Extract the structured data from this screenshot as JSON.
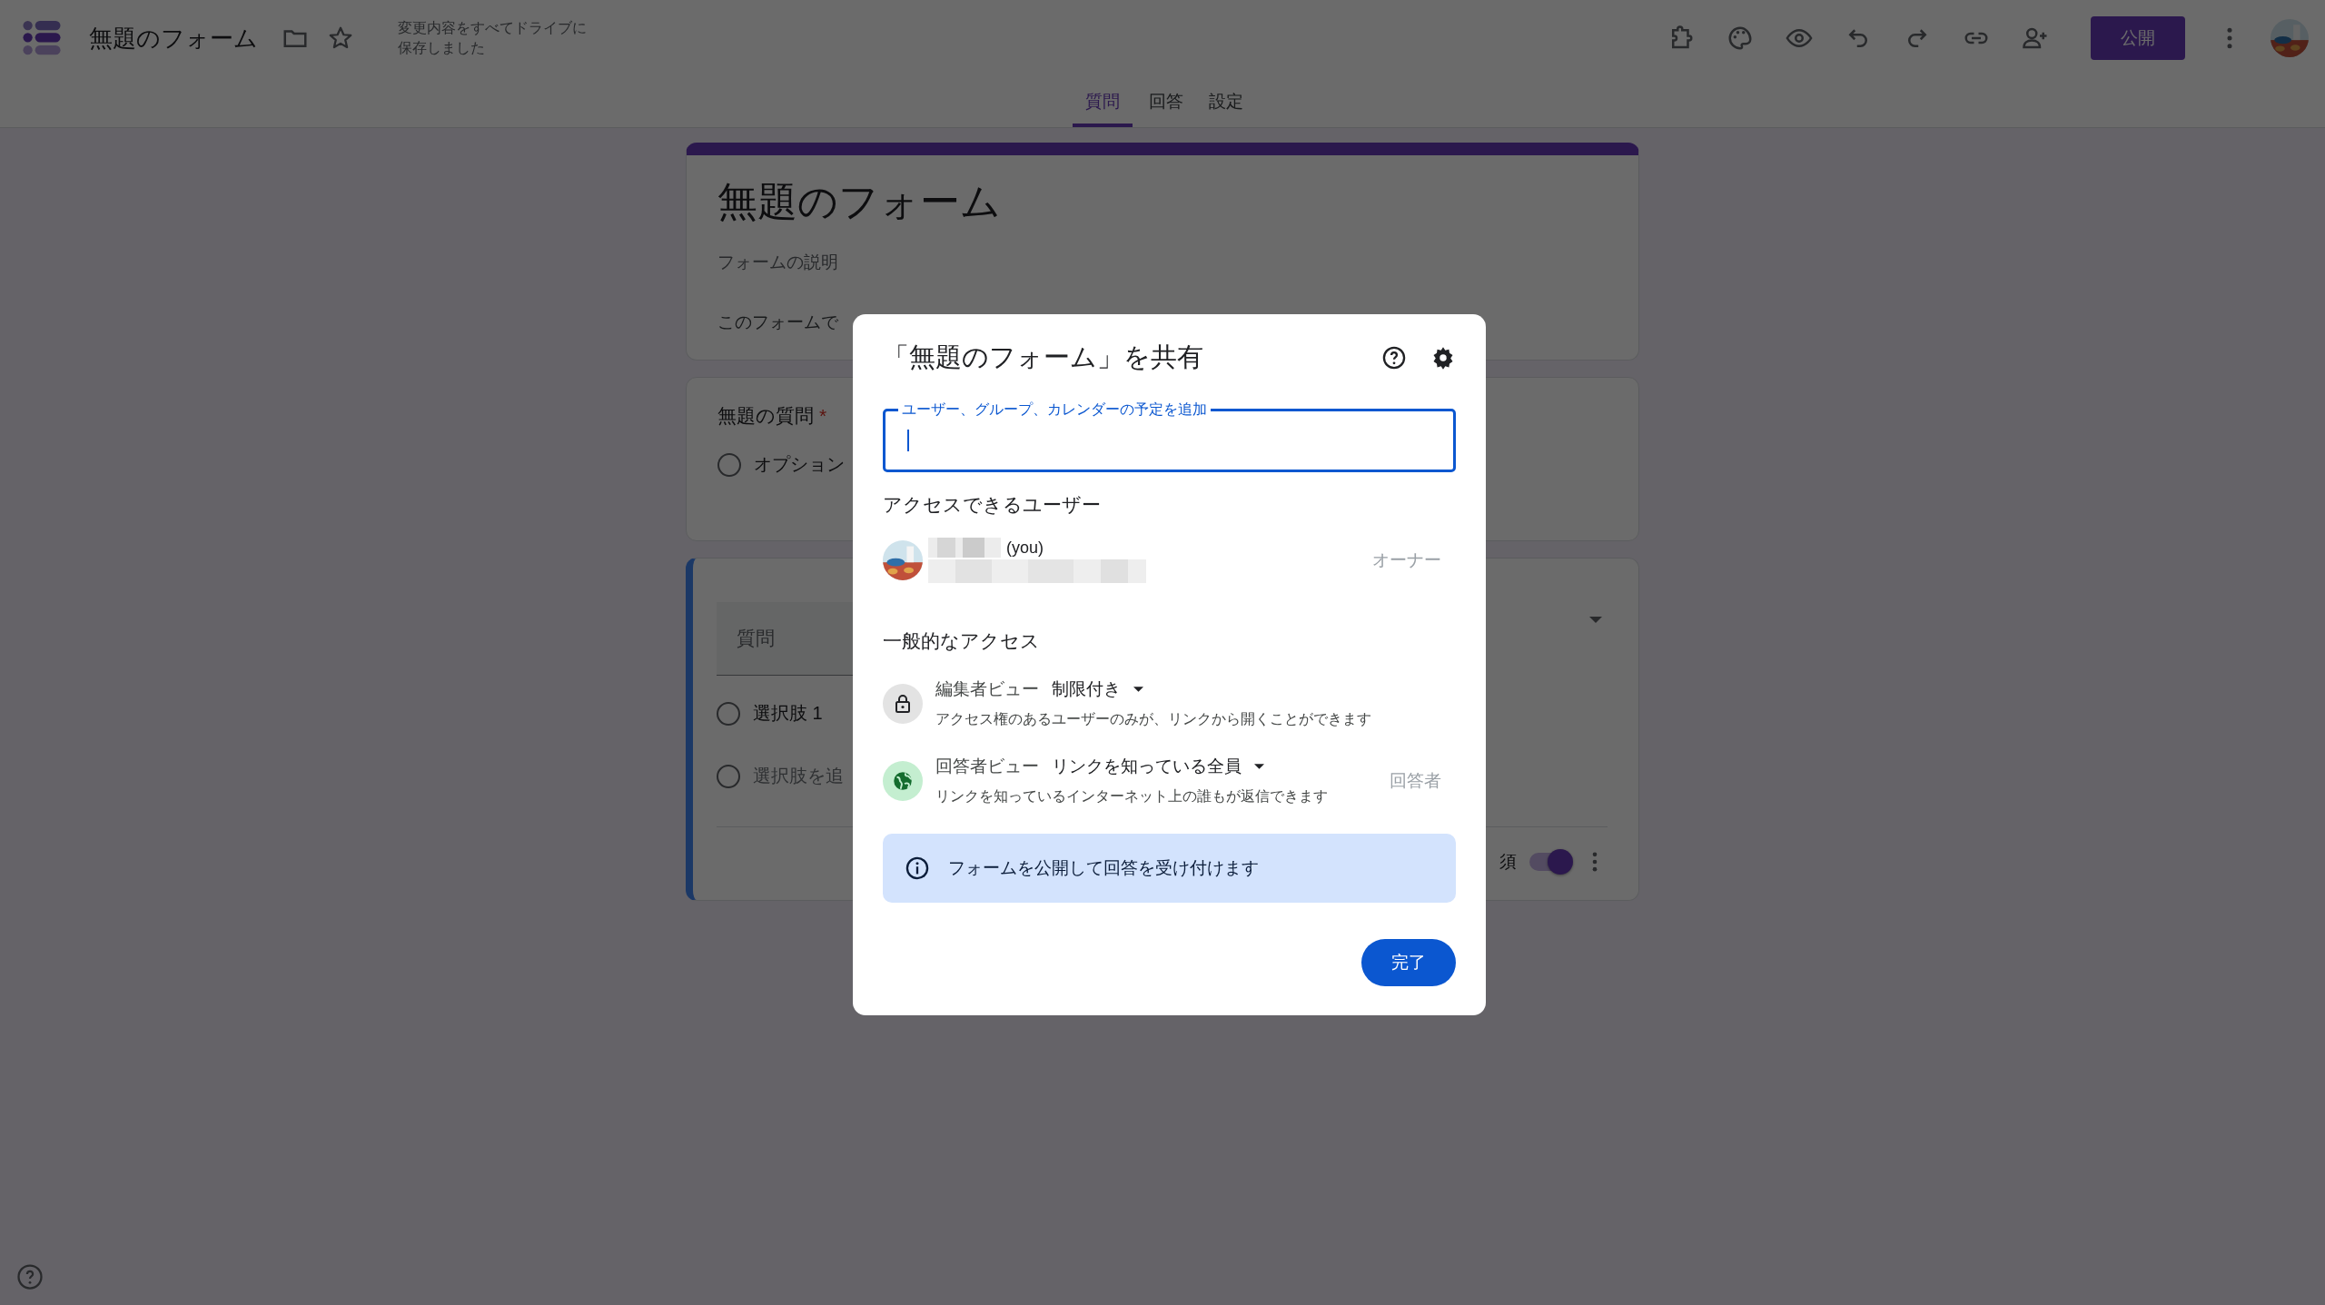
{
  "app": {
    "title": "無題のフォーム",
    "save_status": [
      "変更内容をすべてドライブに",
      "保存しました"
    ],
    "publish_button": "公開"
  },
  "tabs": [
    {
      "label": "質問",
      "selected": true
    },
    {
      "label": "回答",
      "selected": false
    },
    {
      "label": "設定",
      "selected": false
    }
  ],
  "form": {
    "title": "無題のフォーム",
    "description": "フォームの説明",
    "notice": "このフォームで",
    "questions": [
      {
        "title": "無題の質問",
        "required_mark": "*",
        "active": false,
        "options": [
          "オプション"
        ]
      },
      {
        "title": "質問",
        "active": true,
        "options": [
          "選択肢 1",
          "選択肢を追"
        ],
        "required_label": "須",
        "required_on": true
      }
    ]
  },
  "share_dialog": {
    "title": "「無題のフォーム」を共有",
    "add_field": {
      "label": "ユーザー、グループ、カレンダーの予定を追加",
      "focused": true
    },
    "people_heading": "アクセスできるユーザー",
    "people": [
      {
        "name_suffix": "(you)",
        "role": "オーナー"
      }
    ],
    "general_heading": "一般的なアクセス",
    "access": [
      {
        "kind": "restricted",
        "view": "編集者ビュー",
        "setting": "制限付き",
        "description": "アクセス権のあるユーザーのみが、リンクから開くことができます"
      },
      {
        "kind": "public",
        "view": "回答者ビュー",
        "setting": "リンクを知っている全員",
        "description": "リンクを知っているインターネット上の誰もが返信できます",
        "role": "回答者"
      }
    ],
    "info_banner": "フォームを公開して回答を受け付けます",
    "done_button": "完了"
  }
}
